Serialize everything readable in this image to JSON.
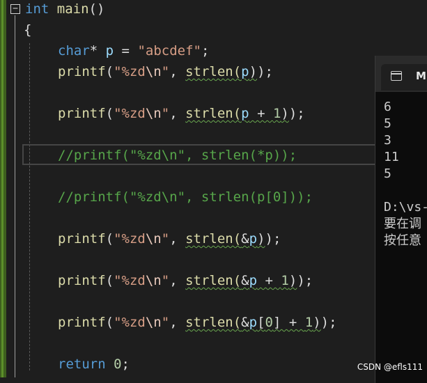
{
  "editor": {
    "lines": [
      {
        "parts": [
          {
            "t": "int",
            "c": "kw"
          },
          {
            "t": " "
          },
          {
            "t": "main",
            "c": "fn"
          },
          {
            "t": "()"
          }
        ]
      },
      {
        "parts": [
          {
            "t": "{"
          }
        ]
      },
      {
        "parts": [
          {
            "t": "char",
            "c": "kw"
          },
          {
            "t": "* "
          },
          {
            "t": "p",
            "c": "var"
          },
          {
            "t": " = "
          },
          {
            "t": "\"abcdef\"",
            "c": "str"
          },
          {
            "t": ";"
          }
        ]
      },
      {
        "parts": [
          {
            "t": "printf",
            "c": "fn"
          },
          {
            "t": "("
          },
          {
            "t": "\"%zd",
            "c": "str"
          },
          {
            "t": "\\n",
            "c": "esc"
          },
          {
            "t": "\"",
            "c": "str"
          },
          {
            "t": ", "
          },
          {
            "t": "strlen(",
            "c": "fn sq"
          },
          {
            "t": "p",
            "c": "var sq"
          },
          {
            "t": ")",
            "c": "sq"
          },
          {
            "t": ");"
          }
        ]
      },
      {
        "parts": [
          {
            "t": "printf",
            "c": "fn"
          },
          {
            "t": "("
          },
          {
            "t": "\"%zd",
            "c": "str"
          },
          {
            "t": "\\n",
            "c": "esc"
          },
          {
            "t": "\"",
            "c": "str"
          },
          {
            "t": ", "
          },
          {
            "t": "strlen(",
            "c": "fn sq"
          },
          {
            "t": "p",
            "c": "var sq"
          },
          {
            "t": " + ",
            "c": "sq"
          },
          {
            "t": "1",
            "c": "num sq"
          },
          {
            "t": ")",
            "c": "sq"
          },
          {
            "t": ");"
          }
        ]
      },
      {
        "parts": [
          {
            "t": "//printf(\"%zd\\n\", strlen(*p));",
            "c": "cmt"
          }
        ]
      },
      {
        "parts": [
          {
            "t": "//printf(\"%zd\\n\", strlen(p[0]));",
            "c": "cmt"
          }
        ]
      },
      {
        "parts": [
          {
            "t": "printf",
            "c": "fn"
          },
          {
            "t": "("
          },
          {
            "t": "\"%zd",
            "c": "str"
          },
          {
            "t": "\\n",
            "c": "esc"
          },
          {
            "t": "\"",
            "c": "str"
          },
          {
            "t": ", "
          },
          {
            "t": "strlen(",
            "c": "fn sq"
          },
          {
            "t": "&",
            "c": "sq"
          },
          {
            "t": "p",
            "c": "var sq"
          },
          {
            "t": ")",
            "c": "sq"
          },
          {
            "t": ");"
          }
        ]
      },
      {
        "parts": [
          {
            "t": "printf",
            "c": "fn"
          },
          {
            "t": "("
          },
          {
            "t": "\"%zd",
            "c": "str"
          },
          {
            "t": "\\n",
            "c": "esc"
          },
          {
            "t": "\"",
            "c": "str"
          },
          {
            "t": ", "
          },
          {
            "t": "strlen(",
            "c": "fn sq"
          },
          {
            "t": "&",
            "c": "sq"
          },
          {
            "t": "p",
            "c": "var sq"
          },
          {
            "t": " + ",
            "c": "sq"
          },
          {
            "t": "1",
            "c": "num sq"
          },
          {
            "t": ")",
            "c": "sq"
          },
          {
            "t": ");"
          }
        ]
      },
      {
        "parts": [
          {
            "t": "printf",
            "c": "fn"
          },
          {
            "t": "("
          },
          {
            "t": "\"%zd",
            "c": "str"
          },
          {
            "t": "\\n",
            "c": "esc"
          },
          {
            "t": "\"",
            "c": "str"
          },
          {
            "t": ", "
          },
          {
            "t": "strlen(",
            "c": "fn sq"
          },
          {
            "t": "&",
            "c": "sq"
          },
          {
            "t": "p",
            "c": "var sq"
          },
          {
            "t": "[",
            "c": "sq"
          },
          {
            "t": "0",
            "c": "num sq"
          },
          {
            "t": "] + ",
            "c": "sq"
          },
          {
            "t": "1",
            "c": "num sq"
          },
          {
            "t": ")",
            "c": "sq"
          },
          {
            "t": ");"
          }
        ]
      },
      {
        "parts": [
          {
            "t": "return",
            "c": "kw"
          },
          {
            "t": " "
          },
          {
            "t": "0",
            "c": "num"
          },
          {
            "t": ";"
          }
        ]
      }
    ]
  },
  "console": {
    "tab_icon": "terminal-window-icon",
    "tab_title": "Mi",
    "output": [
      "6",
      "5",
      "3",
      "11",
      "5",
      "",
      "D:\\vs-",
      "要在调",
      "按任意"
    ]
  },
  "watermark": "CSDN @efls111",
  "colors": {
    "background": "#1e1e1e",
    "keyword": "#569cd6",
    "function": "#dcdcaa",
    "string": "#d69d85",
    "comment": "#57a64a",
    "number": "#b5cea8",
    "variable": "#9cdcfe"
  }
}
